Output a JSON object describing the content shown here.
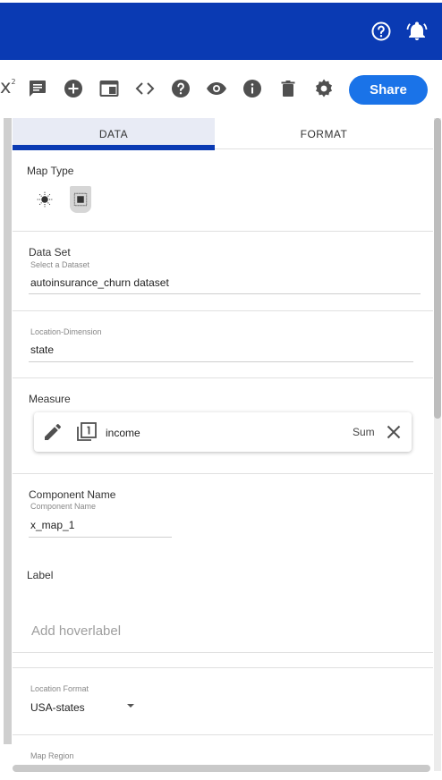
{
  "topbar": {
    "background": "#0a3ab3",
    "icons": [
      "help-circle-icon",
      "bell-icon"
    ]
  },
  "toolbar": {
    "partial_label": "x",
    "partial_sup": "2",
    "icons": [
      "comment-icon",
      "add-circle-icon",
      "window-icon",
      "code-icon",
      "help-icon",
      "eye-icon",
      "info-icon",
      "delete-icon",
      "gear-icon"
    ],
    "share_label": "Share",
    "share_color": "#1a73e8"
  },
  "tabs": {
    "data": "DATA",
    "format": "FORMAT"
  },
  "map_type": {
    "label": "Map Type",
    "options": [
      "point-map-icon",
      "region-map-icon"
    ],
    "selected": "region-map-icon"
  },
  "dataset": {
    "label": "Data Set",
    "hint": "Select a Dataset",
    "value": "autoinsurance_churn dataset"
  },
  "location_dimension": {
    "hint": "Location-Dimension",
    "value": "state"
  },
  "measure": {
    "label": "Measure",
    "field": "income",
    "aggregation": "Sum"
  },
  "component_name": {
    "label": "Component Name",
    "hint": "Component Name",
    "value": "x_map_1"
  },
  "hover_label": {
    "label": "Label",
    "placeholder": "Add hoverlabel"
  },
  "location_format": {
    "hint": "Location Format",
    "value": "USA-states"
  },
  "map_region": {
    "hint": "Map Region"
  }
}
